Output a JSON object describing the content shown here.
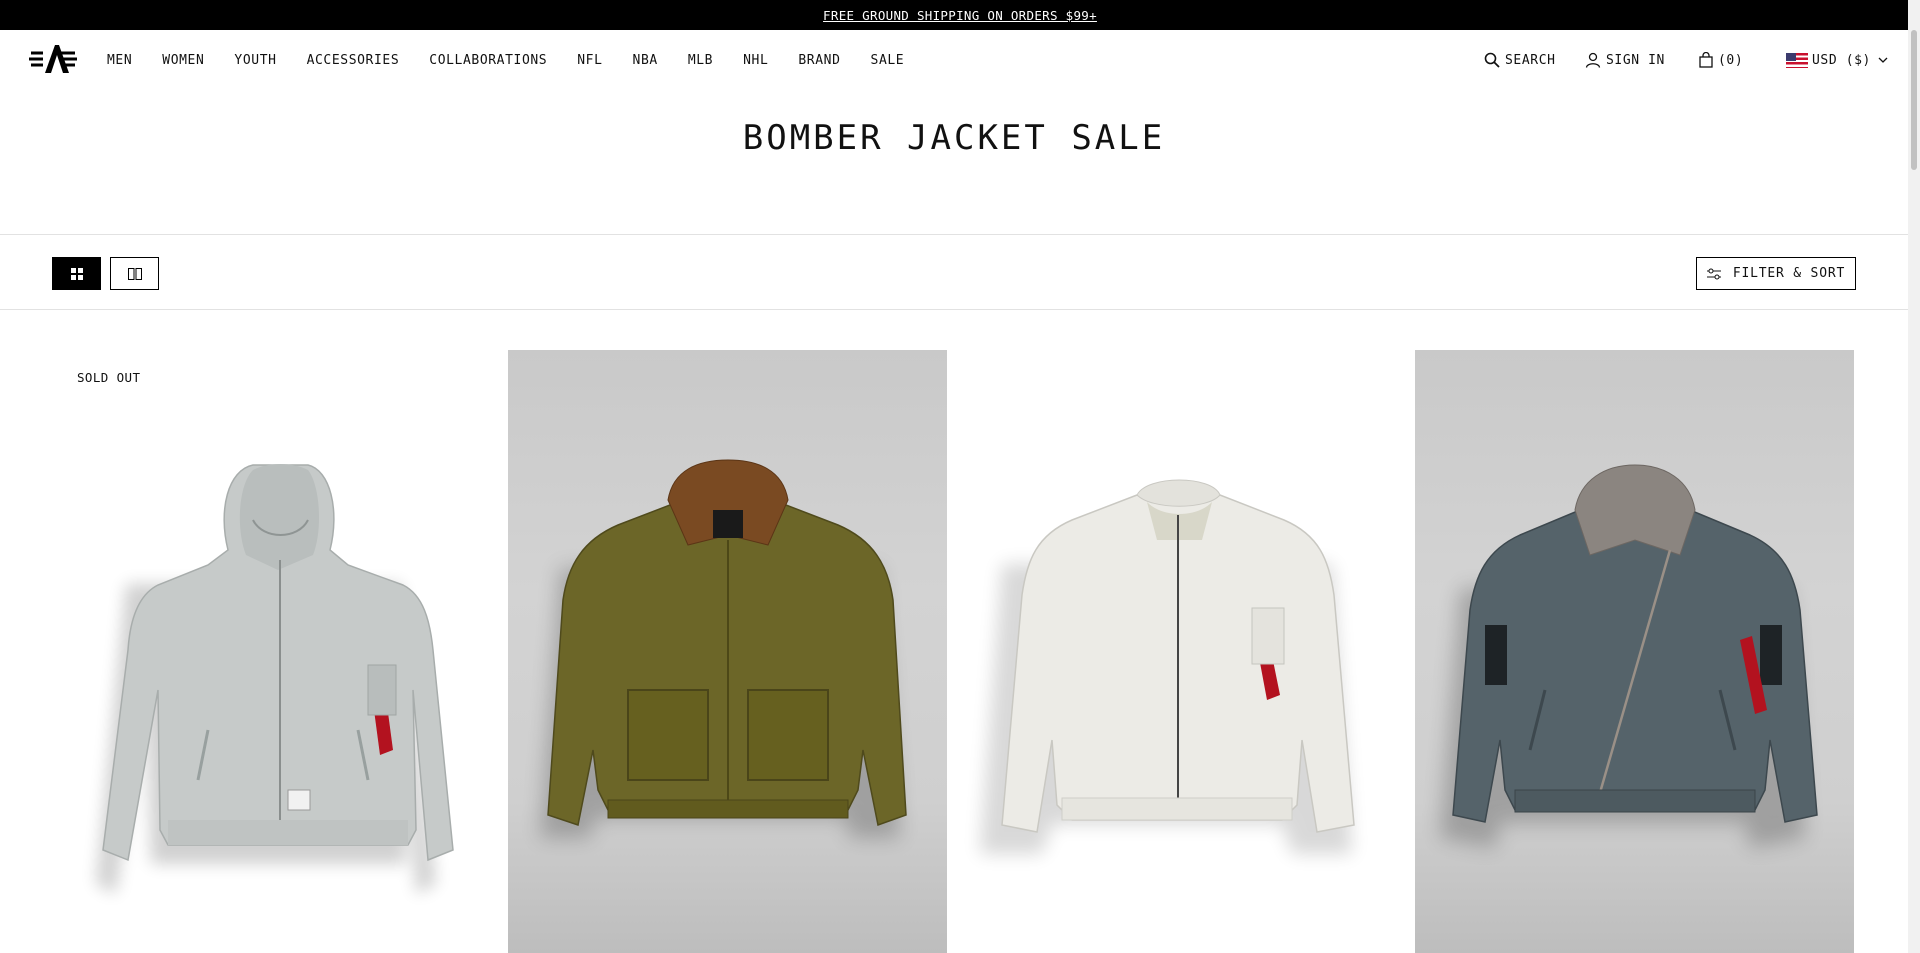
{
  "announcement": {
    "text": "FREE GROUND SHIPPING ON ORDERS $99+"
  },
  "header": {
    "logo_icon": "alpha-industries-logo-icon",
    "nav": [
      "MEN",
      "WOMEN",
      "YOUTH",
      "ACCESSORIES",
      "COLLABORATIONS",
      "NFL",
      "NBA",
      "MLB",
      "NHL",
      "BRAND",
      "SALE"
    ],
    "search_label": "SEARCH",
    "signin_label": "SIGN IN",
    "cart_label": "(0)",
    "currency_label": "USD ($)"
  },
  "page": {
    "title": "BOMBER JACKET SALE"
  },
  "toolbar": {
    "view_options": [
      "grid-4-icon",
      "grid-2-icon"
    ],
    "filter_label": "FILTER & SORT"
  },
  "products": [
    {
      "badge": "SOLD OUT",
      "color": "#c6cac9",
      "background": "white",
      "style": "hooded"
    },
    {
      "badge": "",
      "color": "#6c6628",
      "background": "gray",
      "style": "fur-collar-pockets"
    },
    {
      "badge": "",
      "color": "#ecebe6",
      "background": "white",
      "style": "ma1"
    },
    {
      "badge": "",
      "color": "#55636a",
      "background": "gray",
      "style": "fur-collar-asym"
    }
  ],
  "colors": {
    "accent": "#000000",
    "tag_red": "#b3121f"
  }
}
